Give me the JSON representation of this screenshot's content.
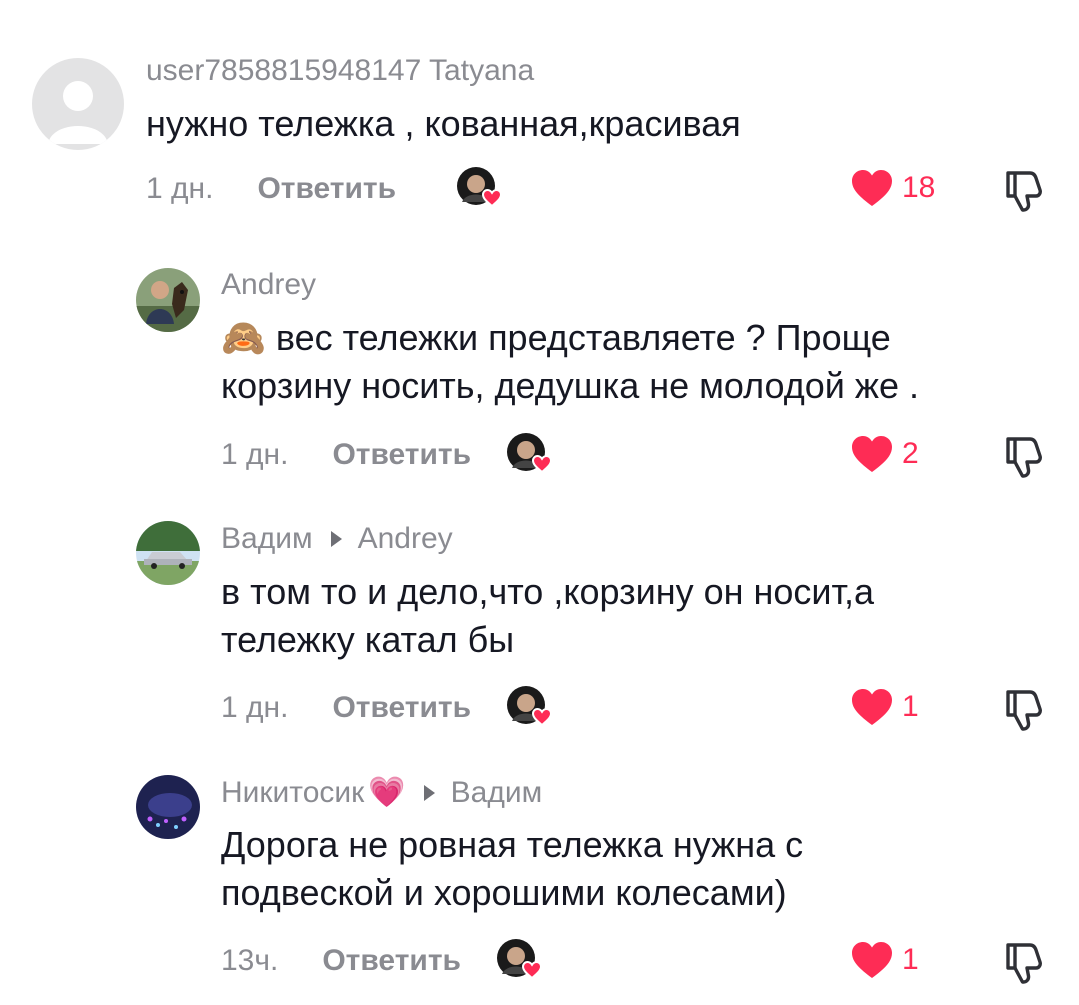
{
  "colors": {
    "like": "#fe2c55",
    "muted": "#8a8b91",
    "text": "#161823"
  },
  "comments": [
    {
      "username": "user7858815948147 Tatyana",
      "reply_to": "",
      "text": "нужно тележка , кованная,красивая",
      "time": "1 дн.",
      "reply_label": "Ответить",
      "likes": "18",
      "avatar_icon": "default-avatar-icon"
    },
    {
      "username": "Andrey",
      "reply_to": "",
      "emoji": "🙈",
      "text": "вес тележки представляете ? Проще корзину носить, дедушка не молодой же .",
      "time": "1 дн.",
      "reply_label": "Ответить",
      "likes": "2",
      "avatar_icon": "user-photo-avatar"
    },
    {
      "username": "Вадим",
      "reply_to": "Andrey",
      "text": "в том то и дело,что ,корзину он носит,а тележку катал бы",
      "time": "1 дн.",
      "reply_label": "Ответить",
      "likes": "1",
      "avatar_icon": "car-photo-avatar"
    },
    {
      "username": "Никитосик",
      "username_emoji": "💗",
      "reply_to": "Вадим",
      "text": "Дорога не ровная тележка нужна с подвеской и хорошими колесами)",
      "time": "13ч.",
      "reply_label": "Ответить",
      "likes": "1",
      "avatar_icon": "night-photo-avatar"
    }
  ]
}
